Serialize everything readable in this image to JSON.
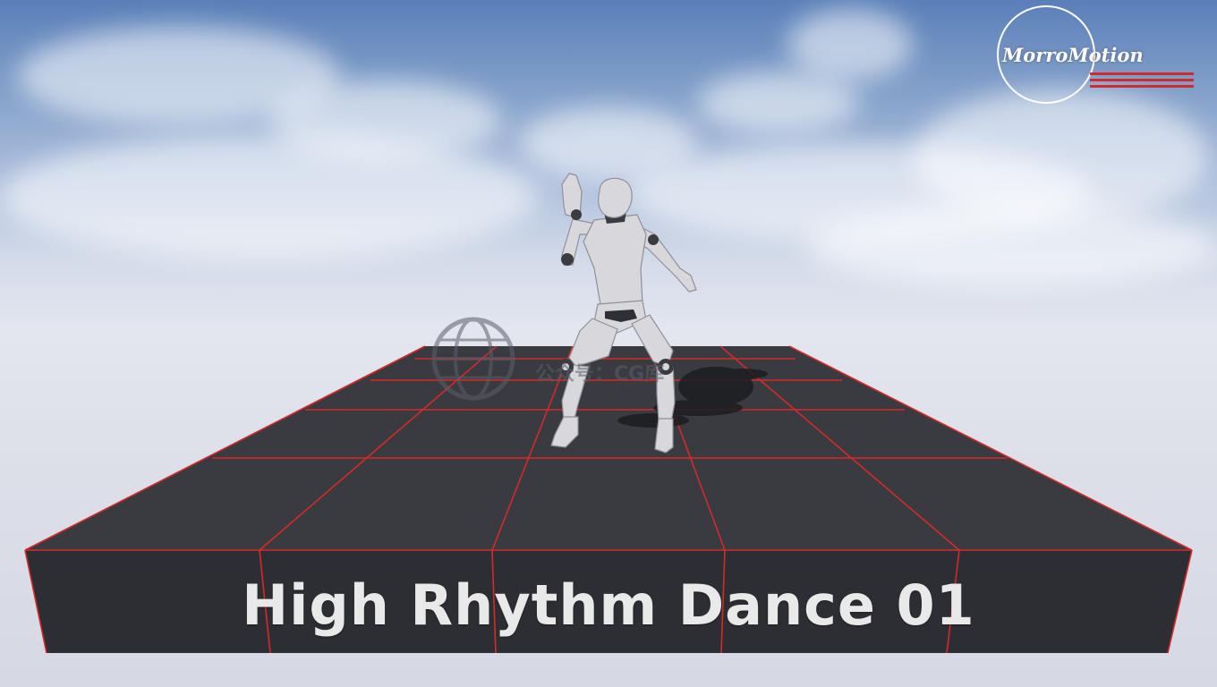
{
  "logo": {
    "text": "MorroMotion"
  },
  "overlay": {
    "title": "High Rhythm Dance 01"
  },
  "watermark": {
    "text": "公众号：CG库"
  },
  "colors": {
    "sky_top": "#5a7fb8",
    "horizon": "#e4e6ef",
    "platform_top": "#3a3b40",
    "platform_front": "#2d2e33",
    "grid_lines": "#d42a2a",
    "mannequin": "#d8d8dc",
    "logo_stripes": "#d62a2a"
  },
  "icons": {
    "logo_emblem": "morromotion-logo-icon",
    "watermark_emblem": "globe-icon"
  }
}
